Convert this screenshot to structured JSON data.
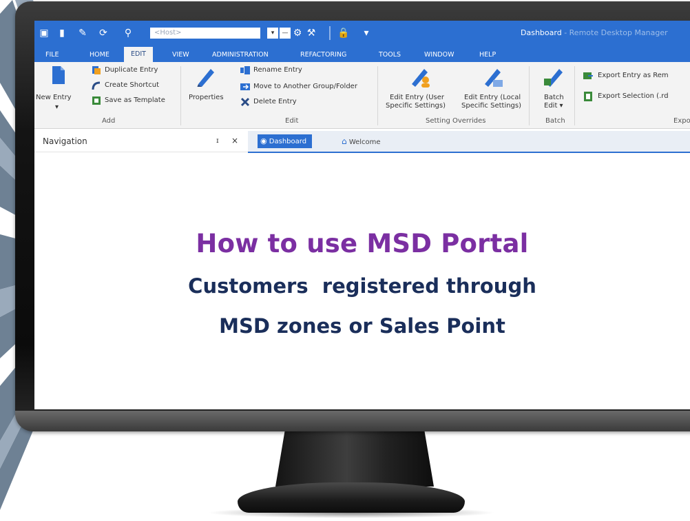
{
  "quick_access": {
    "host_placeholder": "<Host>"
  },
  "window": {
    "title": "Dashboard",
    "app_name": "- Remote Desktop Manager"
  },
  "ribbon_tabs": [
    {
      "label": "FILE"
    },
    {
      "label": "HOME"
    },
    {
      "label": "EDIT",
      "active": true
    },
    {
      "label": "VIEW"
    },
    {
      "label": "ADMINISTRATION"
    },
    {
      "label": "REFACTORING"
    },
    {
      "label": "TOOLS"
    },
    {
      "label": "WINDOW"
    },
    {
      "label": "HELP"
    }
  ],
  "ribbon": {
    "add": {
      "new_entry": "New Entry",
      "duplicate_entry": "Duplicate Entry",
      "create_shortcut": "Create Shortcut",
      "save_as_template": "Save as Template",
      "group_label": "Add"
    },
    "edit": {
      "properties": "Properties",
      "rename_entry": "Rename Entry",
      "move_to_group": "Move to Another Group/Folder",
      "delete_entry": "Delete Entry",
      "group_label": "Edit"
    },
    "setting_overrides": {
      "edit_user": "Edit Entry (User Specific Settings)",
      "edit_user_l1": "Edit Entry (User",
      "edit_user_l2": "Specific Settings)",
      "edit_local_l1": "Edit Entry (Local",
      "edit_local_l2": "Specific Settings)",
      "group_label": "Setting Overrides"
    },
    "batch": {
      "batch_l1": "Batch",
      "batch_l2": "Edit ▾",
      "group_label": "Batch"
    },
    "export": {
      "export_entry": "Export Entry as Rem",
      "export_selection": "Export Selection (.rd",
      "group_label": "Expo"
    }
  },
  "panels": {
    "navigation_title": "Navigation",
    "pin": "ɪ",
    "close": "×"
  },
  "doc_tabs": [
    {
      "label": "Dashboard",
      "active": true
    },
    {
      "label": "Welcome",
      "active": false
    }
  ],
  "content": {
    "headline": "How to use MSD Portal",
    "subline_1": "Customers  registered through",
    "subline_2": "MSD zones or Sales Point"
  },
  "colors": {
    "ribbon_blue": "#2c6fd1",
    "headline_purple": "#7b2fa2",
    "subline_navy": "#1a2e5a",
    "ray_slate": "#6e8194"
  },
  "icons": [
    "monitor-icon",
    "folder-icon",
    "pencil-icon",
    "refresh-icon",
    "search-icon",
    "lock-icon",
    "new-entry-icon",
    "duplicate-icon",
    "shortcut-icon",
    "template-icon",
    "properties-icon",
    "rename-icon",
    "move-icon",
    "delete-icon",
    "edit-user-icon",
    "edit-local-icon",
    "batch-edit-icon",
    "export-icon",
    "dashboard-icon",
    "home-icon"
  ]
}
